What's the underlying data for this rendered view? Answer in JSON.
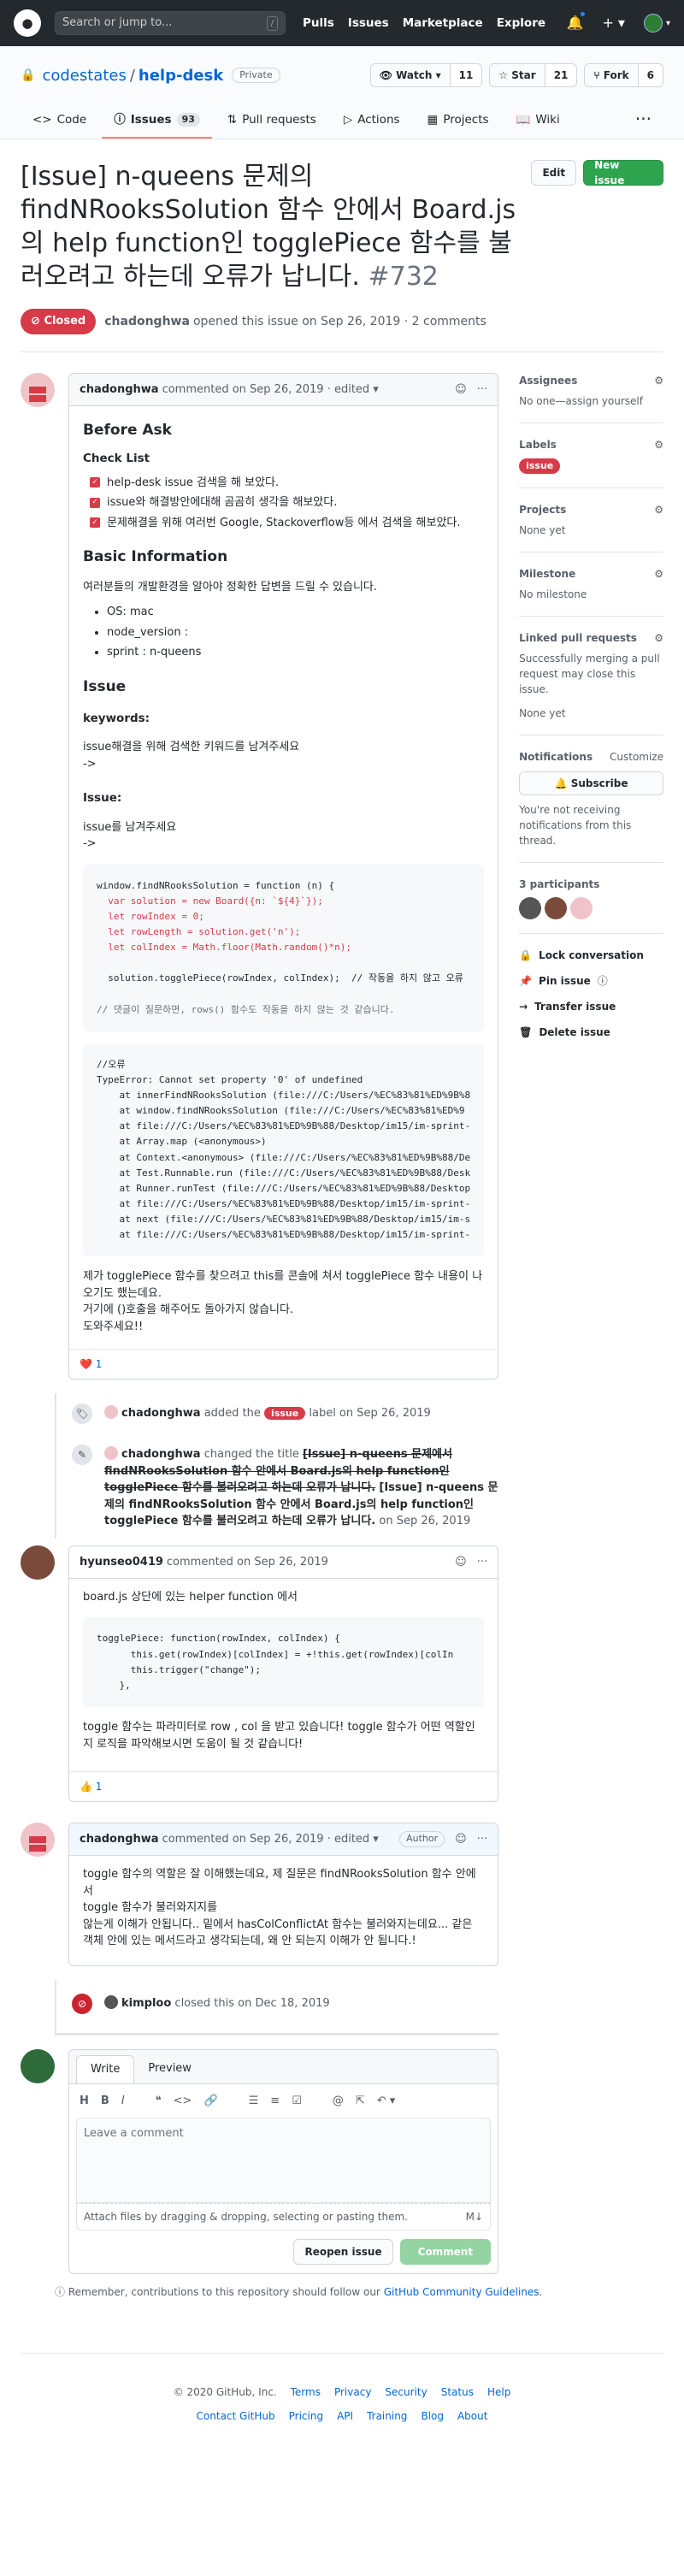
{
  "header": {
    "logo": "github-logo",
    "search_placeholder": "Search or jump to...",
    "search_key": "/",
    "nav": [
      "Pulls",
      "Issues",
      "Marketplace",
      "Explore"
    ]
  },
  "repo": {
    "owner": "codestates",
    "name": "help-desk",
    "visibility": "Private",
    "watch_label": "Watch",
    "watch_count": "11",
    "star_label": "Star",
    "star_count": "21",
    "fork_label": "Fork",
    "fork_count": "6",
    "tabs": [
      {
        "label": "Code",
        "icon": "code-icon"
      },
      {
        "label": "Issues",
        "icon": "issue-icon",
        "count": "93"
      },
      {
        "label": "Pull requests",
        "icon": "pull-request-icon"
      },
      {
        "label": "Actions",
        "icon": "play-icon"
      },
      {
        "label": "Projects",
        "icon": "project-icon"
      },
      {
        "label": "Wiki",
        "icon": "book-icon"
      }
    ]
  },
  "issue": {
    "title": "[Issue] n-queens 문제의 findNRooksSolution 함수 안에서 Board.js의 help function인 togglePiece 함수를 불러오려고 하는데 오류가 납니다.",
    "number": "#732",
    "state": "Closed",
    "edit_label": "Edit",
    "new_issue_label": "New issue",
    "meta_author": "chadonghwa",
    "meta_text": "opened this issue on Sep 26, 2019 · 2 comments"
  },
  "first_comment": {
    "author": "chadonghwa",
    "meta": "commented on Sep 26, 2019 · edited ▾",
    "h_before": "Before Ask",
    "h_checklist": "Check List",
    "checks": [
      "help-desk issue 검색을 해 보았다.",
      "issue와 해결방안에대해 곰곰히 생각을 해보았다.",
      "문제해결을 위해 여러번 Google, Stackoverflow등 에서 검색을 해보았다."
    ],
    "h_basic": "Basic Information",
    "basic_desc": "여러분들의 개발환경을 알아야 정확한 답변을 드릴 수 있습니다.",
    "env": [
      "OS: mac",
      "node_version :",
      "sprint : n-queens"
    ],
    "h_issue": "Issue",
    "h_keywords": "keywords:",
    "keywords_text": "issue해결을 위해 검색한 키워드를 남겨주세요",
    "keywords_arrow": "->",
    "h_issue2": "Issue:",
    "issue_text": "issue를 남겨주세요",
    "issue_arrow": "->",
    "code1": [
      "window.findNRooksSolution = function (n) {",
      "  var solution = new Board({n: `${4}`});",
      "  let rowIndex = 0;",
      "  let rowLength = solution.get('n');",
      "  let colIndex = Math.floor(Math.random()*n);",
      "",
      "  solution.togglePiece(rowIndex, colIndex);  // 작동을 하지 않고 오류",
      "",
      "// 댓글이 질문하면, rows() 함수도 작동을 하지 않는 것 같습니다."
    ],
    "code2": [
      "//오류",
      "TypeError: Cannot set property '0' of undefined",
      "    at innerFindNRooksSolution (file:///C:/Users/%EC%83%81%ED%9B%8",
      "    at window.findNRooksSolution (file:///C:/Users/%EC%83%81%ED%9",
      "    at file:///C:/Users/%EC%83%81%ED%9B%88/Desktop/im15/im-sprint-",
      "    at Array.map (<anonymous>)",
      "    at Context.<anonymous> (file:///C:/Users/%EC%83%81%ED%9B%88/De",
      "    at Test.Runnable.run (file:///C:/Users/%EC%83%81%ED%9B%88/Desk",
      "    at Runner.runTest (file:///C:/Users/%EC%83%81%ED%9B%88/Desktop",
      "    at file:///C:/Users/%EC%83%81%ED%9B%88/Desktop/im15/im-sprint-",
      "    at next (file:///C:/Users/%EC%83%81%ED%9B%88/Desktop/im15/im-s",
      "    at file:///C:/Users/%EC%83%81%ED%9B%88/Desktop/im15/im-sprint-"
    ],
    "closing": [
      "제가 togglePiece 함수를 찾으려고 this를 콘솔에 쳐서 togglePiece 함수 내용이 나오기도 했는데요.",
      "거기에 ()호출을 해주어도 돌아가지 않습니다.",
      "도와주세요!!"
    ],
    "reaction_emoji": "❤️",
    "reaction_count": "1"
  },
  "events": {
    "label_event": {
      "author": "chadonghwa",
      "pre": "added the",
      "label": "issue",
      "post": "label on Sep 26, 2019"
    },
    "rename_event": {
      "author": "chadonghwa",
      "pre": "changed the title",
      "old_title": "[Issue] n-queens 문제에서 findNRooksSolution 함수 안에서 Board.js의 help function인 togglePiece 함수를 불러오려고 하는데 오류가 납니다.",
      "new_title": "[Issue] n-queens 문제의 findNRooksSolution 함수 안에서 Board.js의 help function인 togglePiece 함수를 불러오려고 하는데 오류가 납니다.",
      "date": "on Sep 26, 2019"
    },
    "close_event": {
      "author": "kimploo",
      "text": "closed this on Dec 18, 2019"
    }
  },
  "second_comment": {
    "author": "hyunseo0419",
    "meta": "commented on Sep 26, 2019",
    "intro": "board.js 상단에 있는 helper function 에서",
    "code": [
      "togglePiece: function(rowIndex, colIndex) {",
      "      this.get(rowIndex)[colIndex] = +!this.get(rowIndex)[colIn",
      "      this.trigger(\"change\");",
      "    },"
    ],
    "outro": "toggle 함수는 파라미터로 row , col 을 받고 있습니다! toggle 함수가 어떤 역할인 지 로직을 파악해보시면 도움이 될 것 같습니다!",
    "reaction_emoji": "👍",
    "reaction_count": "1"
  },
  "third_comment": {
    "author": "chadonghwa",
    "meta": "commented on Sep 26, 2019 · edited ▾",
    "badge": "Author",
    "lines": [
      "toggle 함수의 역할은 잘 이해했는데요, 제 질문은 findNRooksSolution 함수 안에서",
      "toggle 함수가 불러와지지를",
      "않는게 이해가 안됩니다.. 밑에서 hasColConflictAt 함수는 불러와지는데요... 같은 객체 안에 있는 메서드라고 생각되는데, 왜 안 되는지 이해가 안 됩니다.!"
    ]
  },
  "new_comment": {
    "tab_write": "Write",
    "tab_preview": "Preview",
    "placeholder": "Leave a comment",
    "attach": "Attach files by dragging & dropping, selecting or pasting them.",
    "reopen": "Reopen issue",
    "comment": "Comment",
    "remember_pre": "Remember, contributions to this repository should follow our",
    "remember_link": "GitHub Community Guidelines",
    "remember_post": "."
  },
  "sidebar": {
    "assignees_h": "Assignees",
    "assignees_v": "No one—assign yourself",
    "labels_h": "Labels",
    "labels_v": "issue",
    "projects_h": "Projects",
    "projects_v": "None yet",
    "milestone_h": "Milestone",
    "milestone_v": "No milestone",
    "linked_h": "Linked pull requests",
    "linked_desc": "Successfully merging a pull request may close this issue.",
    "linked_v": "None yet",
    "notif_h": "Notifications",
    "notif_custom": "Customize",
    "subscribe": "Subscribe",
    "notif_desc": "You're not receiving notifications from this thread.",
    "participants_h": "3 participants",
    "actions": [
      "Lock conversation",
      "Pin issue",
      "Transfer issue",
      "Delete issue"
    ]
  },
  "footer": {
    "copyright": "© 2020 GitHub, Inc.",
    "row1": [
      "Terms",
      "Privacy",
      "Security",
      "Status",
      "Help"
    ],
    "row2": [
      "Contact GitHub",
      "Pricing",
      "API",
      "Training",
      "Blog",
      "About"
    ]
  },
  "colors": {
    "accent": "#0366d6",
    "closed": "#d73a49",
    "green": "#2ea44f"
  }
}
